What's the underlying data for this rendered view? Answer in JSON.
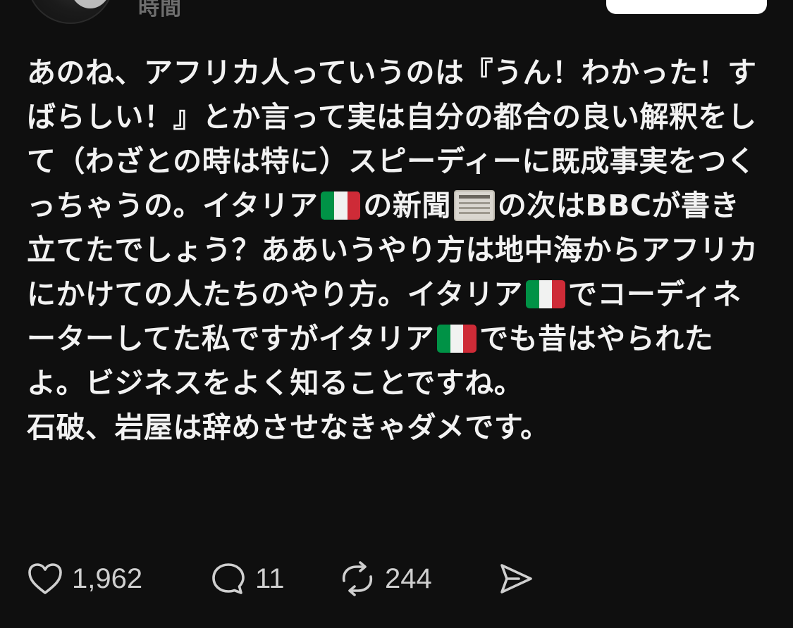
{
  "header": {
    "timestamp": "時間"
  },
  "post": {
    "paragraphs": [
      {
        "segments": [
          {
            "type": "text",
            "value": "あのね、アフリカ人っていうのは『うん！わかった！すばらしい！』とか言って実は自分の都合の良い解釈をして（わざとの時は特に）スピーディーに既成事実をつくっちゃうの。イタリア"
          },
          {
            "type": "emoji",
            "icon": "italy-flag-icon"
          },
          {
            "type": "text",
            "value": "の新聞"
          },
          {
            "type": "emoji",
            "icon": "newspaper-icon"
          },
          {
            "type": "text",
            "value": "の次はBBCが書き立てたでしょう？ああいうやり方は地中海からアフリカにかけての人たちのやり方。イタリア"
          },
          {
            "type": "emoji",
            "icon": "italy-flag-icon"
          },
          {
            "type": "text",
            "value": "でコーディネーターしてた私ですがイタリア"
          },
          {
            "type": "emoji",
            "icon": "italy-flag-icon"
          },
          {
            "type": "text",
            "value": "でも昔はやられたよ。ビジネスをよく知ることですね。"
          }
        ]
      },
      {
        "segments": [
          {
            "type": "text",
            "value": "石破、岩屋は辞めさせなきゃダメです。"
          }
        ]
      }
    ]
  },
  "actions": {
    "like_count": "1,962",
    "reply_count": "11",
    "repost_count": "244",
    "icons": {
      "like": "heart-icon",
      "reply": "comment-bubble-icon",
      "repost": "repost-arrows-icon",
      "share": "send-icon"
    }
  },
  "colors": {
    "background": "#0f0f0f",
    "text": "#f2f2f2",
    "muted": "#6e6e6e",
    "icon": "#cfcfcf",
    "flag_green": "#009246",
    "flag_white": "#f1f2f1",
    "flag_red": "#ce2b37"
  }
}
